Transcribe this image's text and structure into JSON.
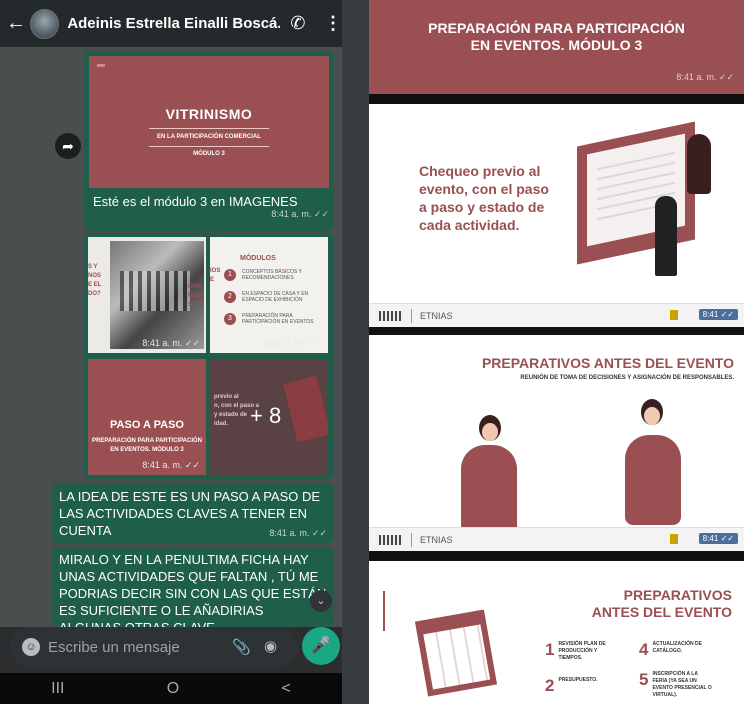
{
  "header": {
    "contact_name": "Adeinis Estrella Einalli Boscá..."
  },
  "messages": {
    "m1": {
      "thumb_title": "VITRINISMO",
      "thumb_subtitle": "EN LA PARTICIPACIÓN COMERCIAL",
      "thumb_module": "MÓDULO 3",
      "caption": "Esté es el módulo 3 en IMAGENES",
      "time": "8:41 a. m."
    },
    "m2": {
      "cell1_text": "S Y\nNOS\nE EL\nDO?",
      "cell1_text2": "ÓMO\nMOS\nSTO?",
      "cell2_title": "MÓDULOS",
      "cell2_left": "IOS\nE",
      "cell2_items": [
        {
          "num": "1",
          "text": "CONCEPTOS BÁSICOS Y RECOMENDACIONES"
        },
        {
          "num": "2",
          "text": "EN ESPACIO DE CASA Y EN ESPACIO DE EXHIBICIÓN"
        },
        {
          "num": "3",
          "text": "PREPARACIÓN PARA PARTICIPACIÓN EN EVENTOS"
        }
      ],
      "cell3_title": "PASO A PASO",
      "cell3_sub": "PREPARACIÓN PARA PARTICIPACIÓN EN EVENTOS. MÓDULO 3",
      "cell4_text": "previo al\nn, con el paso a\ny estado de\nidad.",
      "more_count": "+ 8",
      "time": "8:41 a. m."
    },
    "m3": {
      "text": "LA IDEA DE ESTE ES UN PASO A PASO DE LAS ACTIVIDADES CLAVES A TENER EN CUENTA",
      "time": "8:41 a. m."
    },
    "m4": {
      "text": "MIRALO Y EN LA PENULTIMA FICHA HAY UNAS ACTIVIDADES QUE FALTAN , TÚ ME PODRIAS DECIR SIN CON LAS QUE ESTÁN ES SUFICIENTE O LE AÑADIRIAS ALGUNAS OTRAS CLAVE"
    }
  },
  "composer": {
    "placeholder": "Escribe un mensaje"
  },
  "navbar": {
    "recents": "III",
    "home": "O",
    "back": "<"
  },
  "slides": {
    "s1": {
      "title_line1": "PREPARACIÓN PARA PARTICIPACIÓN",
      "title_line2": "EN EVENTOS. MÓDULO 3",
      "time": "8:41 a. m."
    },
    "s2": {
      "text": "Chequeo previo al evento, con el paso a paso y estado de cada actividad.",
      "footer_label": "ETNIAS",
      "footer_time": "8:41"
    },
    "s3": {
      "title": "PREPARATIVOS ANTES DEL EVENTO",
      "subtitle": "REUNIÓN DE TOMA DE DECISIONES Y ASIGNACIÓN DE RESPONSABLES.",
      "footer_label": "ETNIAS",
      "footer_time": "8:41"
    },
    "s4": {
      "title_line1": "PREPARATIVOS",
      "title_line2": "ANTES DEL EVENTO",
      "items": [
        {
          "num": "1",
          "text": "REVISIÓN PLAN DE PRODUCCIÓN Y TIEMPOS."
        },
        {
          "num": "4",
          "text": "ACTUALIZACIÓN DE CATÁLOGO."
        },
        {
          "num": "2",
          "text": "PRESUPUESTO."
        },
        {
          "num": "5",
          "text": "INSCRIPCIÓN A LA FERIA (YA SEA UN EVENTO PRESENCIAL O VIRTUAL)."
        }
      ]
    }
  },
  "colors": {
    "accent": "#9a4f53",
    "bubble": "#1f5e4b",
    "mic": "#1aa884"
  }
}
